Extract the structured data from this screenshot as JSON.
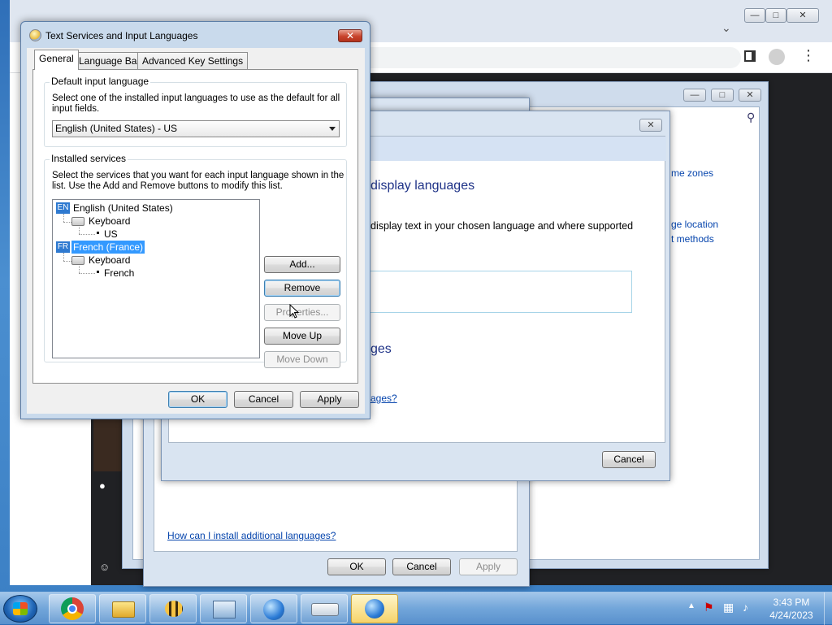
{
  "text_services": {
    "title": "Text Services and Input Languages",
    "tabs": [
      "General",
      "Language Bar",
      "Advanced Key Settings"
    ],
    "default_input": {
      "group_label": "Default input language",
      "description": "Select one of the installed input languages to use as the default for all input fields.",
      "selected": "English (United States) - US"
    },
    "installed_services": {
      "group_label": "Installed services",
      "description": "Select the services that you want for each input language shown in the list. Use the Add and Remove buttons to modify this list.",
      "tree": {
        "lang1_badge": "EN",
        "lang1": "English (United States)",
        "lang1_kbd": "Keyboard",
        "lang1_layout": "US",
        "lang2_badge": "FR",
        "lang2": "French (France)",
        "lang2_kbd": "Keyboard",
        "lang2_layout": "French"
      },
      "buttons": {
        "add": "Add...",
        "remove": "Remove",
        "properties": "Properties...",
        "move_up": "Move Up",
        "move_down": "Move Down"
      }
    },
    "footer": {
      "ok": "OK",
      "cancel": "Cancel",
      "apply": "Apply"
    }
  },
  "display_language_dialog": {
    "heading": "display languages",
    "description": "display text in your chosen language and where supported",
    "heading2": "ges",
    "link": "ages?",
    "cancel": "Cancel"
  },
  "region_dialog": {
    "link": "How can I install additional languages?",
    "ok": "OK",
    "cancel": "Cancel",
    "apply": "Apply"
  },
  "control_panel": {
    "link1": "me zones",
    "link2": "ge location",
    "link3": "t methods"
  },
  "taskbar": {
    "time": "3:43 PM",
    "date": "4/24/2023"
  }
}
